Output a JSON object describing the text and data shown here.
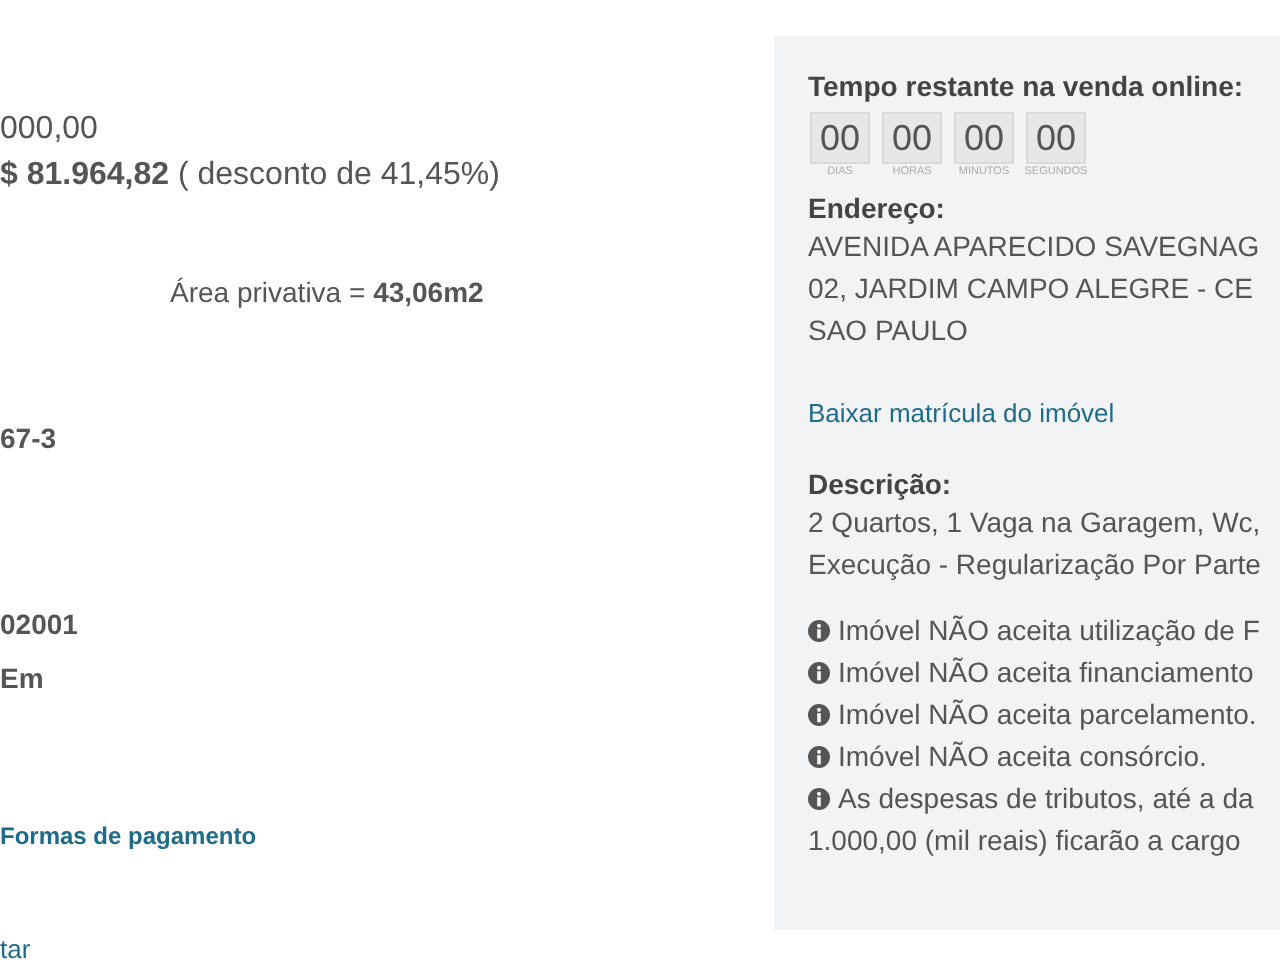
{
  "main": {
    "price_original": "000,00",
    "price_sale": "**$ 81.964,82** ( desconto de 41,45%)",
    "area": "Área privativa = **43,06m2**",
    "fields": [
      {
        "kind": "value",
        "text": "67-3"
      },
      {
        "kind": "value",
        "text": "02001"
      },
      {
        "kind": "value",
        "text": "Em"
      },
      {
        "kind": "link",
        "text": "Formas de pagamento"
      },
      {
        "kind": "link",
        "text": "tar"
      }
    ]
  },
  "panel": {
    "countdown_title": "Tempo restante na venda online:",
    "countdown": [
      {
        "value": "00",
        "label": "DIAS"
      },
      {
        "value": "00",
        "label": "HORAS"
      },
      {
        "value": "00",
        "label": "MINUTOS"
      },
      {
        "value": "00",
        "label": "SEGUNDOS"
      }
    ],
    "address_title": "Endereço:",
    "address_lines": [
      "AVENIDA APARECIDO SAVEGNAG",
      "02, JARDIM CAMPO ALEGRE - CE",
      "SAO PAULO"
    ],
    "download_link": "Baixar matrícula do imóvel",
    "description_title": "Descrição:",
    "description_lines": [
      "2 Quartos, 1 Vaga na Garagem, Wc,",
      "Execução - Regularização Por Parte"
    ],
    "notices": [
      "Imóvel NÃO aceita utilização de F",
      "Imóvel NÃO aceita financiamento",
      "Imóvel NÃO aceita parcelamento.",
      "Imóvel NÃO aceita consórcio.",
      "As despesas de tributos, até a da"
    ],
    "notice_continuation": "1.000,00 (mil reais) ficarão a cargo"
  }
}
